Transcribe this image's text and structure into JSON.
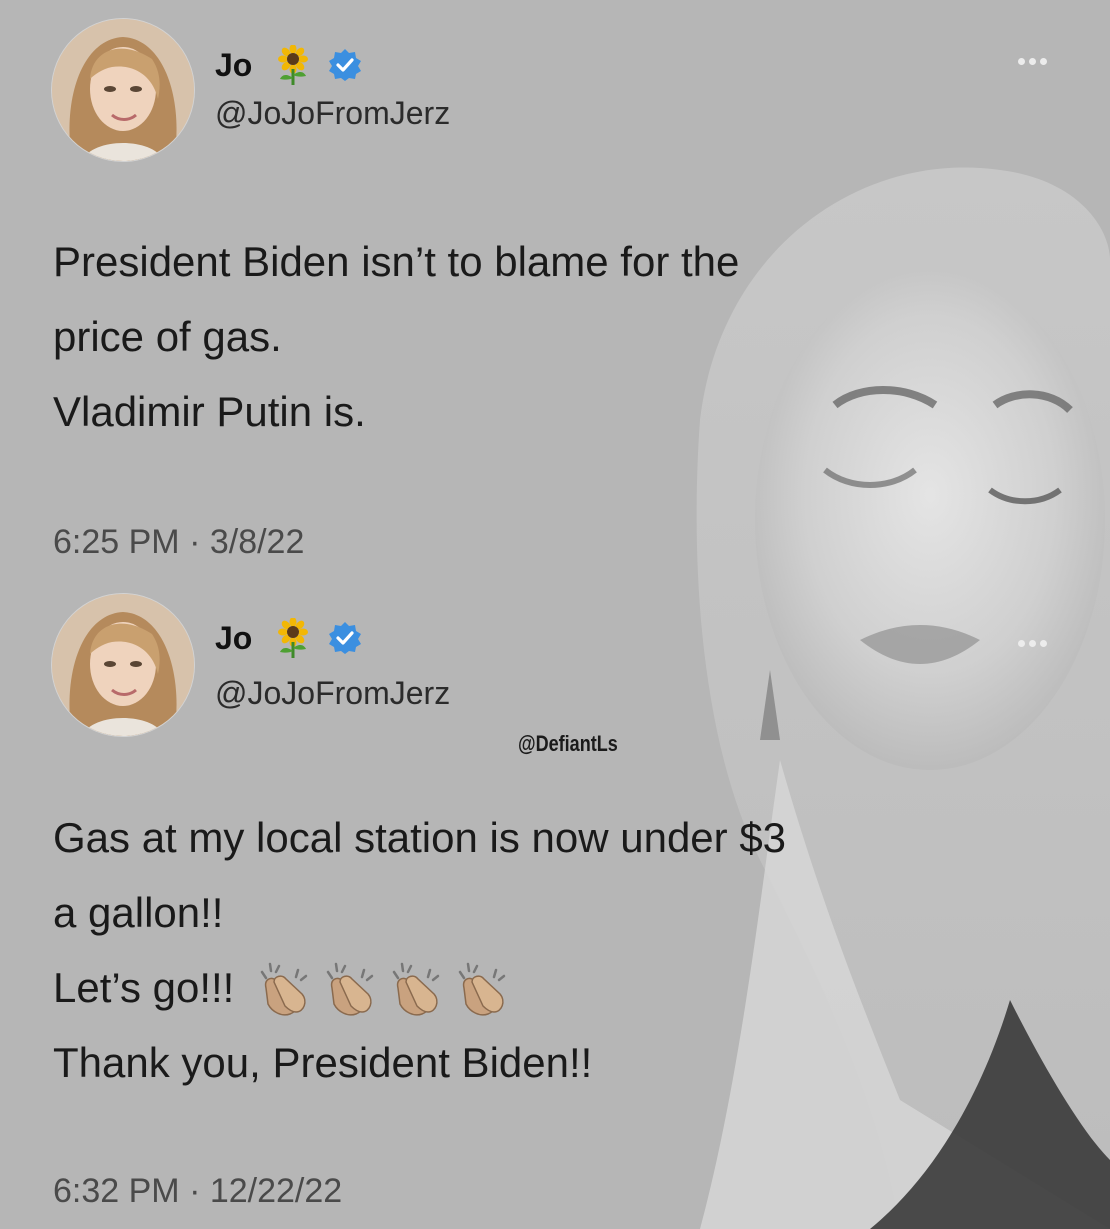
{
  "tweets": [
    {
      "display_name": "Jo",
      "name_emoji": "sunflower-icon",
      "verified": true,
      "handle": "@JoJoFromJerz",
      "lines": [
        "President Biden isn’t to blame for the",
        "price of gas.",
        "Vladimir Putin is."
      ],
      "timestamp": "6:25 PM · 3/8/22"
    },
    {
      "display_name": "Jo",
      "name_emoji": "sunflower-icon",
      "verified": true,
      "handle": "@JoJoFromJerz",
      "lines": [
        "Gas at my local station is now under $3",
        "a gallon!!",
        "Let’s go!!!",
        "Thank you, President Biden!!"
      ],
      "line_3_emoji": [
        "clapping-hands-icon",
        "clapping-hands-icon",
        "clapping-hands-icon",
        "clapping-hands-icon"
      ],
      "timestamp": "6:32 PM · 12/22/22"
    }
  ],
  "watermark": "@DefiantLs",
  "colors": {
    "background": "#b6b6b6",
    "verified_badge": "#3b8fe0",
    "text": "#1a1a1a"
  }
}
